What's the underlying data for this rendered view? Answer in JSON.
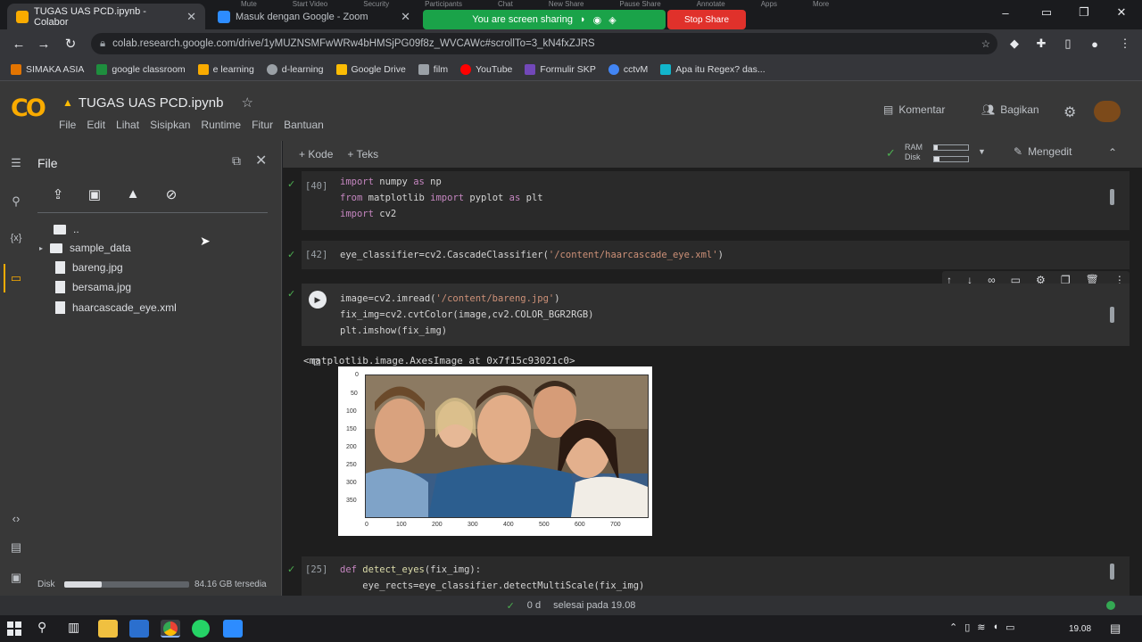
{
  "browser": {
    "tabs": [
      {
        "label": "TUGAS UAS PCD.ipynb - Colabor",
        "close": "✕"
      },
      {
        "label": "Masuk dengan Google - Zoom",
        "close": "✕"
      }
    ],
    "new_tab": "+",
    "zoom_toolbar": [
      "Mute",
      "Start Video",
      "Security",
      "Participants",
      "Chat",
      "New Share",
      "Pause Share",
      "Annotate",
      "Apps",
      "More"
    ],
    "sharing_text": "You are screen sharing",
    "stop_share_label": "Stop Share",
    "url": "colab.research.google.com/drive/1yMUZNSMFwWRw4bHMSjPG09f8z_WVCAWc#scrollTo=3_kN4fxZJRS",
    "bookmarks": [
      "SIMAKA ASIA",
      "google classroom",
      "e learning",
      "d-learning",
      "Google Drive",
      "film",
      "YouTube",
      "Formulir SKP",
      "cctvM",
      "Apa itu Regex? das..."
    ]
  },
  "colab": {
    "notebook_title": "TUGAS UAS PCD.ipynb",
    "menu": [
      "File",
      "Edit",
      "Lihat",
      "Sisipkan",
      "Runtime",
      "Fitur",
      "Bantuan"
    ],
    "comment_label": "Komentar",
    "share_label": "Bagikan",
    "sidebar": {
      "title": "File",
      "files": [
        {
          "name": "..",
          "type": "folder"
        },
        {
          "name": "sample_data",
          "type": "folder"
        },
        {
          "name": "bareng.jpg",
          "type": "file"
        },
        {
          "name": "bersama.jpg",
          "type": "file"
        },
        {
          "name": "haarcascade_eye.xml",
          "type": "file"
        }
      ],
      "disk_label": "Disk",
      "disk_info": "84.16 GB tersedia",
      "disk_fraction": 0.3
    },
    "toolbar": {
      "add_code": "+ Kode",
      "add_text": "+ Teks",
      "ram_label": "RAM",
      "disk_label": "Disk",
      "edit_label": "Mengedit"
    },
    "cells": [
      {
        "count": "[40]",
        "lines": [
          "import numpy as np",
          "from matplotlib import pyplot as plt",
          "import cv2"
        ]
      },
      {
        "count": "[42]",
        "lines": [
          "eye_classifier=cv2.CascadeClassifier('/content/haarcascade_eye.xml')"
        ]
      },
      {
        "count": "",
        "lines": [
          "image=cv2.imread('/content/bareng.jpg')",
          "fix_img=cv2.cvtColor(image,cv2.COLOR_BGR2RGB)",
          "plt.imshow(fix_img)"
        ]
      },
      {
        "count": "[25]",
        "lines": [
          "def detect_eyes(fix_img):",
          "    eye_rects=eye_classifier.detectMultiScale(fix_img)"
        ]
      }
    ],
    "output_text": "<matplotlib.image.AxesImage at 0x7f15c93021c0>",
    "plot": {
      "y_ticks": [
        "0",
        "50",
        "100",
        "150",
        "200",
        "250",
        "300",
        "350"
      ],
      "x_ticks": [
        "0",
        "100",
        "200",
        "300",
        "400",
        "500",
        "600",
        "700"
      ]
    },
    "status": {
      "check": "✓",
      "time": "0 d",
      "done_text": "selesai pada 19.08"
    }
  },
  "taskbar": {
    "clock": "19.08"
  },
  "colors": {
    "accent_green": "#1aa349",
    "stop_red": "#e0312b",
    "colab_orange": "#f9ab00"
  }
}
